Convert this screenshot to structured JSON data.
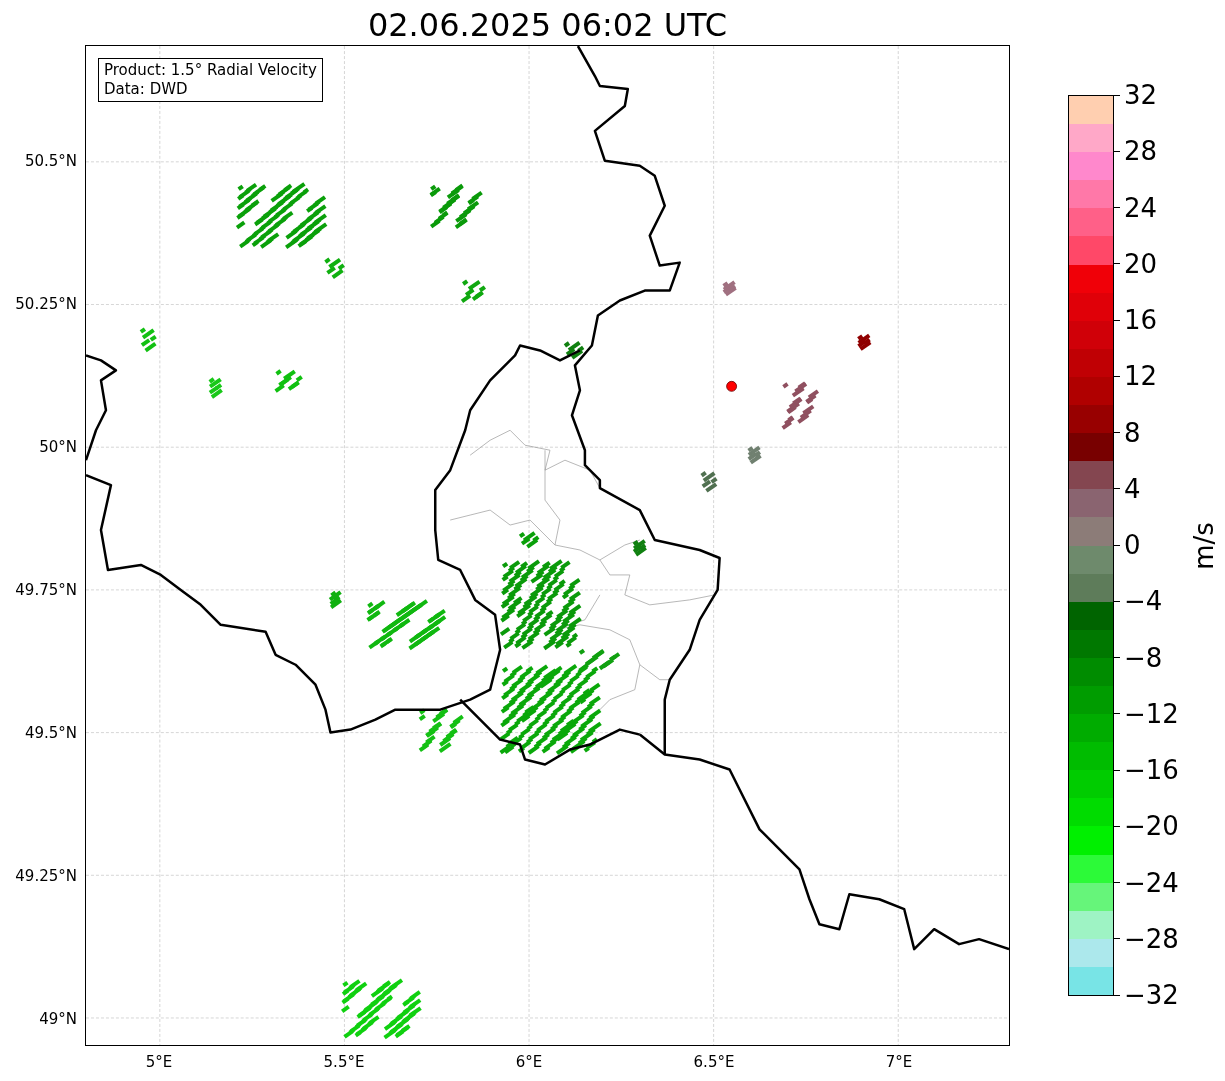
{
  "title": "02.06.2025 06:02 UTC",
  "info_box": [
    "Product: 1.5° Radial Velocity",
    "Data: DWD"
  ],
  "lat_ticks": [
    "50.5°N",
    "50.25°N",
    "50°N",
    "49.75°N",
    "49.5°N",
    "49.25°N",
    "49°N"
  ],
  "lon_ticks": [
    "5°E",
    "5.5°E",
    "6°E",
    "6.5°E",
    "7°E"
  ],
  "colorbar": {
    "label": "m/s",
    "ticks": [
      "32",
      "28",
      "24",
      "20",
      "16",
      "12",
      "8",
      "4",
      "0",
      "−4",
      "−8",
      "−12",
      "−16",
      "−20",
      "−24",
      "−28",
      "−32"
    ],
    "segments": [
      {
        "color": "#ffcfb0"
      },
      {
        "color": "#ffa8c8"
      },
      {
        "color": "#ff88cc"
      },
      {
        "color": "#ff78a8"
      },
      {
        "color": "#ff6088"
      },
      {
        "color": "#ff4868"
      },
      {
        "color": "#f00008"
      },
      {
        "color": "#e00008"
      },
      {
        "color": "#d00008"
      },
      {
        "color": "#c00004"
      },
      {
        "color": "#b00000"
      },
      {
        "color": "#980000"
      },
      {
        "color": "#780000"
      },
      {
        "color": "#844650"
      },
      {
        "color": "#8a6470"
      },
      {
        "color": "#8c7c78"
      },
      {
        "color": "#6e8a6c"
      },
      {
        "color": "#5e7c5a"
      },
      {
        "color": "#006400"
      },
      {
        "color": "#007800"
      },
      {
        "color": "#008c00"
      },
      {
        "color": "#009c00"
      },
      {
        "color": "#00ac00"
      },
      {
        "color": "#00bc00"
      },
      {
        "color": "#00cc00"
      },
      {
        "color": "#00dc00"
      },
      {
        "color": "#00f000"
      },
      {
        "color": "#2cfa38"
      },
      {
        "color": "#66f57a"
      },
      {
        "color": "#9ef3c4"
      },
      {
        "color": "#ace8ec"
      },
      {
        "color": "#78e4e6"
      }
    ]
  }
}
